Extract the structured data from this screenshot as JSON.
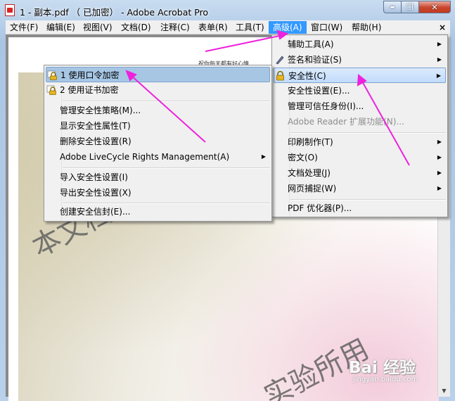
{
  "window": {
    "title": "1 - 副本.pdf （ 已加密） - Adobe Acrobat Pro",
    "buttons": {
      "minimize": "▬",
      "maximize": "❐",
      "close": "✕"
    }
  },
  "menubar": {
    "items": [
      "文件(F)",
      "编辑(E)",
      "视图(V)",
      "文档(D)",
      "注释(C)",
      "表单(R)",
      "工具(T)",
      "高级(A)",
      "窗口(W)",
      "帮助(H)"
    ],
    "active_index": 7,
    "close_label": "×"
  },
  "document": {
    "top_text": "祝你每天都有好心情",
    "watermark_1": "本文档专为学",
    "watermark_2": "实验所用",
    "scroll_up": "▲",
    "scroll_down": "▼"
  },
  "baidu_logo": {
    "main": "Bai 经验",
    "sub": "jingyan.baidu.com"
  },
  "advanced_menu": {
    "items": [
      {
        "label": "辅助工具(A)",
        "submenu": true
      },
      {
        "label": "签名和验证(S)",
        "submenu": true,
        "icon": "pen-icon"
      },
      {
        "label": "安全性(C)",
        "submenu": true,
        "icon": "lock-icon",
        "highlighted": true
      },
      {
        "label": "安全性设置(E)...",
        "submenu": false
      },
      {
        "label": "管理可信任身份(I)...",
        "submenu": false
      },
      {
        "label": "Adobe Reader 扩展功能(N)...",
        "submenu": false,
        "disabled": true
      },
      {
        "label": "印刷制作(T)",
        "submenu": true
      },
      {
        "label": "密文(O)",
        "submenu": true
      },
      {
        "label": "文档处理(J)",
        "submenu": true
      },
      {
        "label": "网页捕捉(W)",
        "submenu": true
      },
      {
        "label": "PDF 优化器(P)...",
        "submenu": false
      }
    ]
  },
  "security_submenu": {
    "items": [
      {
        "label": "1 使用口令加密",
        "icon": "password-lock-icon",
        "highlighted": true
      },
      {
        "label": "2 使用证书加密",
        "icon": "certificate-lock-icon"
      },
      {
        "label": "管理安全性策略(M)..."
      },
      {
        "label": "显示安全性属性(T)"
      },
      {
        "label": "删除安全性设置(R)"
      },
      {
        "label": "Adobe LiveCycle Rights Management(A)",
        "submenu": true
      },
      {
        "label": "导入安全性设置(I)"
      },
      {
        "label": "导出安全性设置(X)"
      },
      {
        "label": "创建安全信封(E)..."
      }
    ]
  },
  "colors": {
    "menu_active": "#3399ff",
    "annotation_arrow": "#ee22dd",
    "highlight": "#c1dbfc"
  }
}
